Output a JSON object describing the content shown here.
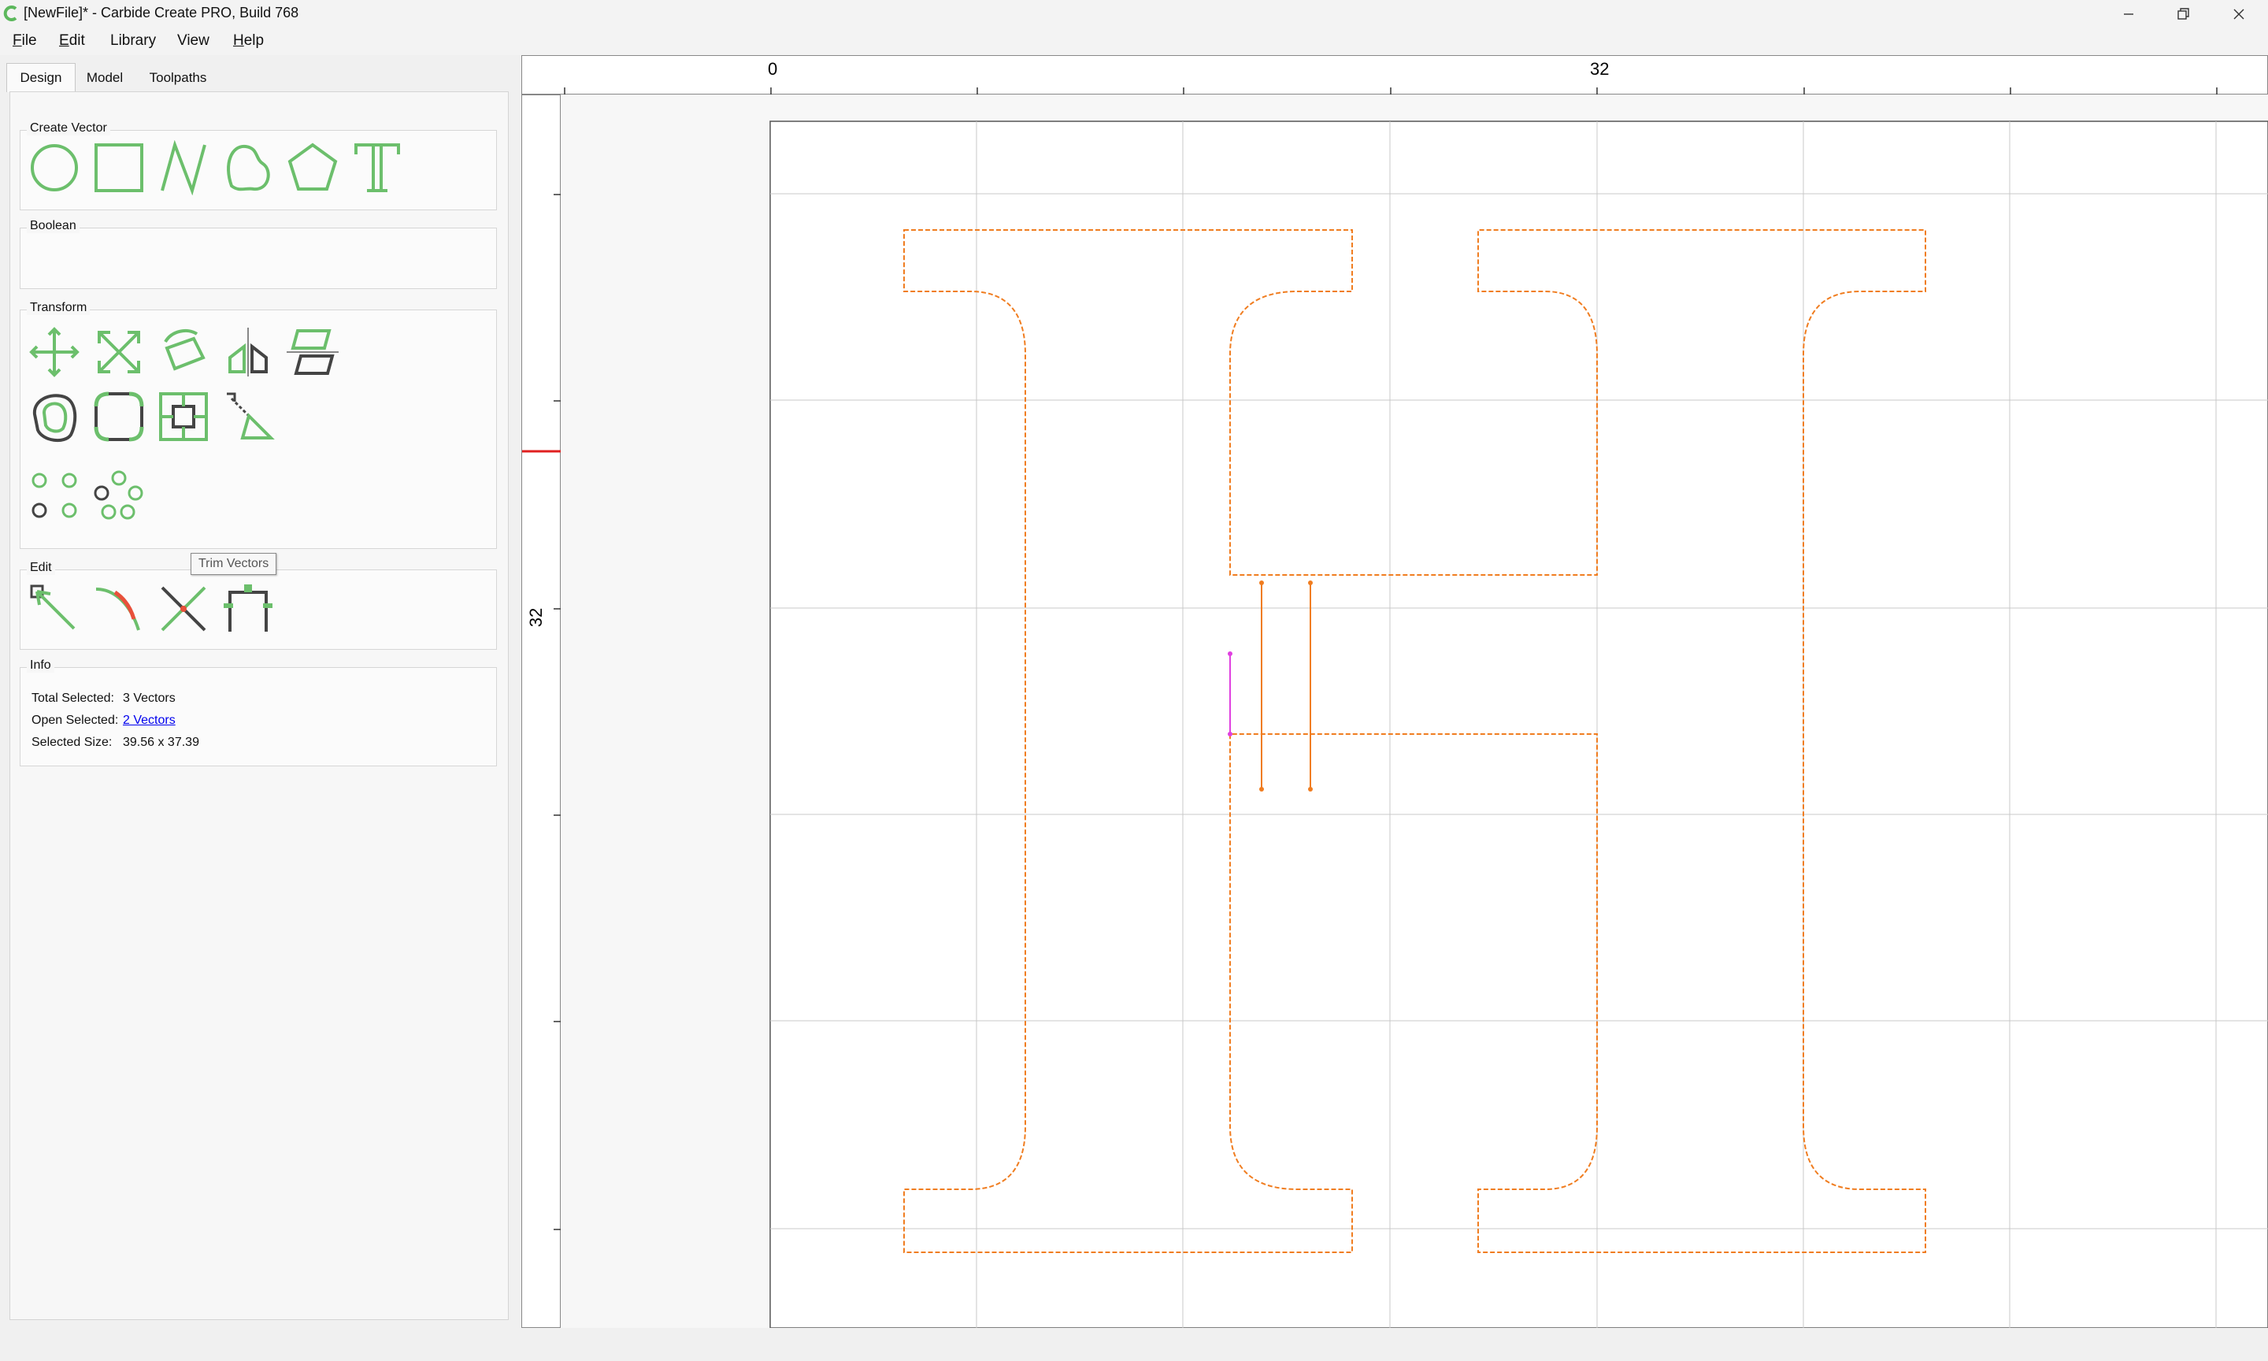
{
  "window": {
    "title": "[NewFile]* - Carbide Create PRO, Build 768",
    "controls": [
      "minimize",
      "restore",
      "close"
    ],
    "accent_color": "#5cb85c"
  },
  "menu": [
    {
      "label": "File",
      "mnemonic": "F",
      "rest": "ile"
    },
    {
      "label": "Edit",
      "mnemonic": "E",
      "rest": "dit"
    },
    {
      "label": "Library",
      "mnemonic": "",
      "rest": "Library"
    },
    {
      "label": "View",
      "mnemonic": "",
      "rest": "View"
    },
    {
      "label": "Help",
      "mnemonic": "H",
      "rest": "elp"
    }
  ],
  "tabs": [
    {
      "label": "Design",
      "active": true
    },
    {
      "label": "Model",
      "active": false
    },
    {
      "label": "Toolpaths",
      "active": false
    }
  ],
  "groups": {
    "create_vector": {
      "title": "Create Vector",
      "tools": [
        "circle-icon",
        "rectangle-icon",
        "polyline-icon",
        "curve-icon",
        "polygon-icon",
        "text-icon"
      ]
    },
    "boolean": {
      "title": "Boolean",
      "tools": []
    },
    "transform": {
      "title": "Transform",
      "tools": [
        "move-icon",
        "scale-icon",
        "rotate-icon",
        "mirror-icon",
        "align-icon",
        "offset-icon",
        "fillet-icon",
        "inset-icon",
        "scale-to-fit-icon",
        "circular-array-icon",
        "linear-array-icon"
      ]
    },
    "edit": {
      "title": "Edit",
      "tools": [
        "node-edit-icon",
        "curve-edit-icon",
        "trim-vectors-icon",
        "join-vectors-icon"
      ]
    },
    "info": {
      "title": "Info",
      "total_selected_label": "Total Selected:",
      "total_selected_value": "3 Vectors",
      "open_selected_label": "Open Selected:",
      "open_selected_value": "2 Vectors",
      "selected_size_label": "Selected Size:",
      "selected_size_value": "39.56 x 37.39"
    }
  },
  "tooltip": "Trim Vectors",
  "canvas": {
    "ruler_top_labels": [
      "0",
      "32"
    ],
    "ruler_left_labels": [
      "32"
    ],
    "vector_color": "#f07d20",
    "selection_color": "#e040e0",
    "grid_color": "#c8c8c8"
  }
}
